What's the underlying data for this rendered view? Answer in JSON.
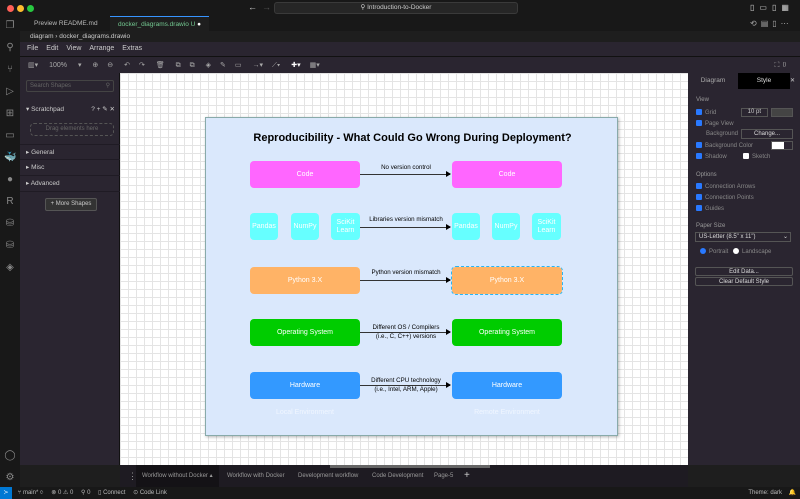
{
  "window": {
    "search": "Introduction-to-Docker"
  },
  "tabs": [
    {
      "label": "Preview README.md"
    },
    {
      "label": "docker_diagrams.drawio U"
    }
  ],
  "breadcrumb": [
    "diagram",
    "docker_diagrams.drawio"
  ],
  "menu": [
    "File",
    "Edit",
    "View",
    "Arrange",
    "Extras"
  ],
  "toolbar": {
    "zoom": "100%"
  },
  "left_panel": {
    "search_placeholder": "Search Shapes",
    "scratchpad": "Scratchpad",
    "drag_hint": "Drag elements here",
    "sections": [
      "General",
      "Misc",
      "Advanced"
    ],
    "more_shapes": "+ More Shapes"
  },
  "diagram": {
    "title": "Reproducibility - What Could Go Wrong During Deployment?",
    "code": "Code",
    "code_arrow": "No version control",
    "libs": [
      "Pandas",
      "NumPy",
      "SciKit Learn"
    ],
    "libs_arrow": "Libraries version mismatch",
    "python": "Python 3.X",
    "python_arrow": "Python version mismatch",
    "os": "Operating System",
    "os_arrow_1": "Different OS / Compilers",
    "os_arrow_2": "(i.e., C, C++) versions",
    "hw": "Hardware",
    "hw_arrow_1": "Different CPU technology",
    "hw_arrow_2": "(i.e., Intel, ARM, Apple)",
    "local": "Local Environment",
    "remote": "Remote Environment",
    "colors": {
      "code": "#ff66ff",
      "libs": "#66ffff",
      "python": "#ffb366",
      "os": "#00cc00",
      "hw": "#3399ff"
    }
  },
  "right_panel": {
    "tabs": [
      "Diagram",
      "Style"
    ],
    "view": "View",
    "grid": "Grid",
    "grid_size": "10 pt",
    "page_view": "Page View",
    "background": "Background",
    "change": "Change...",
    "background_color": "Background Color",
    "shadow": "Shadow",
    "sketch": "Sketch",
    "options": "Options",
    "connection_arrows": "Connection Arrows",
    "connection_points": "Connection Points",
    "guides": "Guides",
    "paper_size": "Paper Size",
    "paper": "US-Letter (8.5\" x 11\")",
    "portrait": "Portrait",
    "landscape": "Landscape",
    "edit_data": "Edit Data...",
    "clear_style": "Clear Default Style"
  },
  "page_tabs": [
    "Workflow without Docker",
    "Workflow with Docker",
    "Development workflow",
    "Code Development",
    "Page-5"
  ],
  "status": {
    "branch": "main*",
    "problems": "0",
    "warnings": "0",
    "ports": "0",
    "connect": "Connect",
    "code_link": "Code Link",
    "theme": "Theme: dark"
  }
}
